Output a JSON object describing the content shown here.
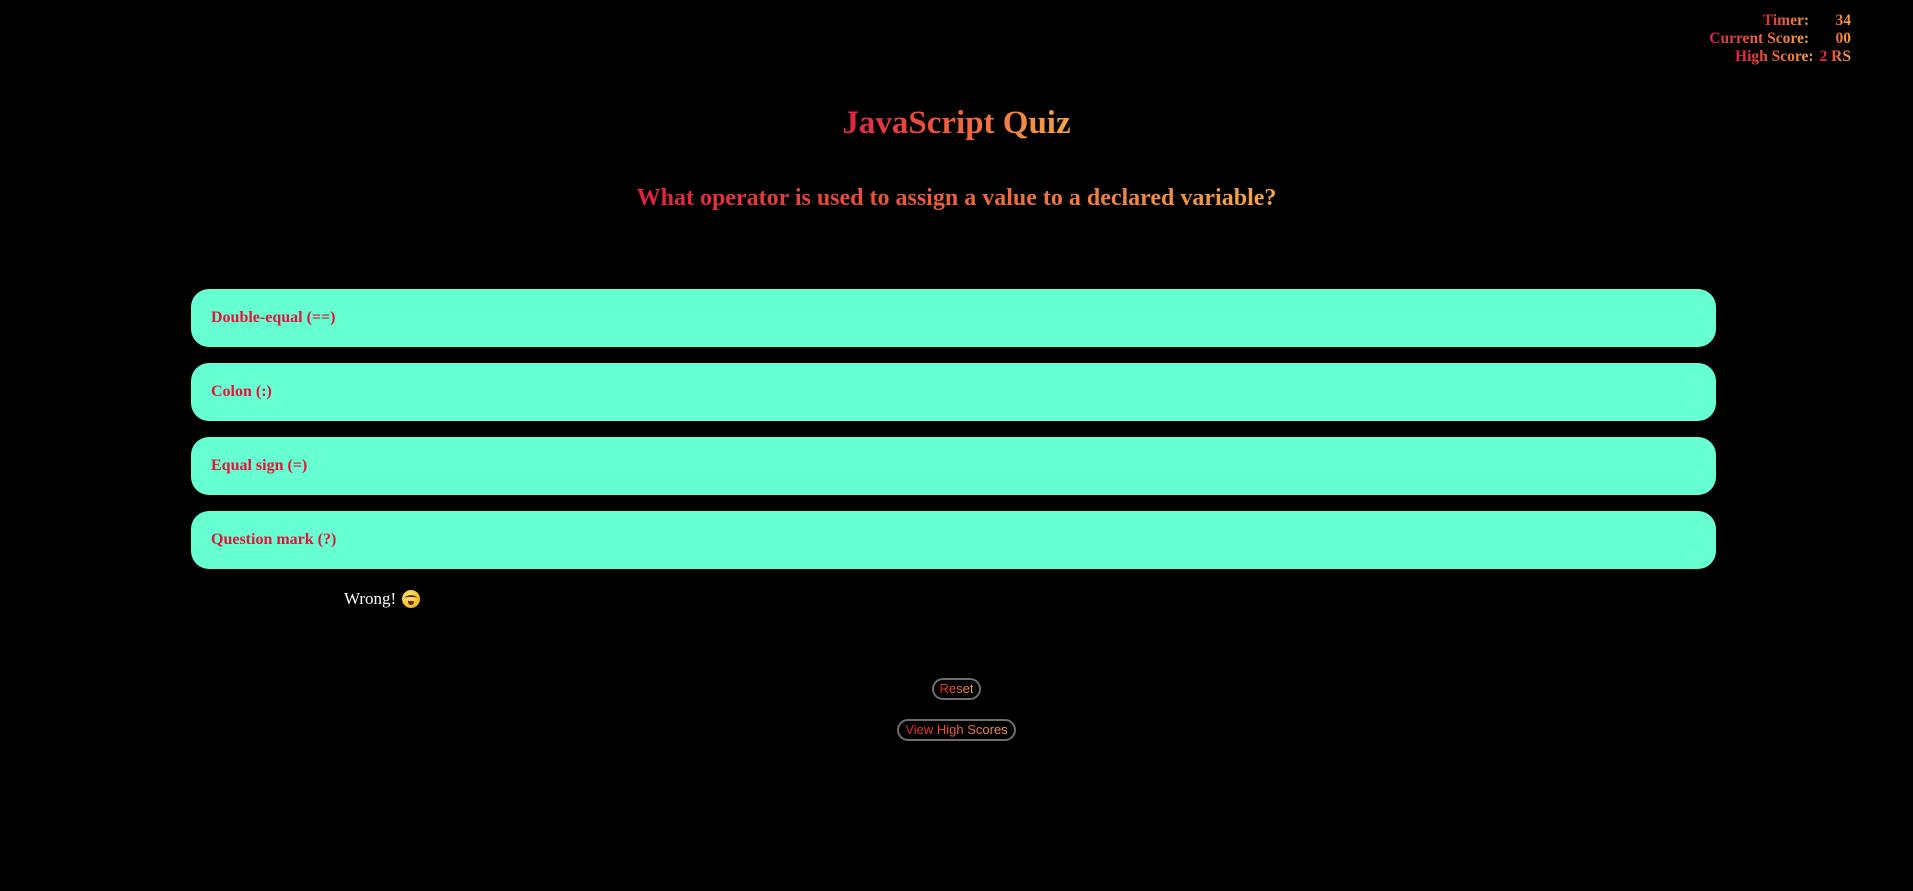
{
  "scoreboard": {
    "timer_label": "Timer:",
    "timer_value": "34",
    "current_label": "Current Score:",
    "current_value": "00",
    "high_label": "High Score:",
    "high_value": "2 RS"
  },
  "title": "JavaScript Quiz",
  "question": "What operator is used to assign a value to a declared variable?",
  "answers": [
    {
      "label": "Double-equal (==)"
    },
    {
      "label": "Colon (:)"
    },
    {
      "label": "Equal sign (=)"
    },
    {
      "label": "Question mark (?)"
    }
  ],
  "feedback": {
    "text": "Wrong!",
    "icon": "dizzy-face-emoji"
  },
  "buttons": {
    "reset": "Reset",
    "view_high_scores": "View High Scores"
  },
  "colors": {
    "background": "#000000",
    "answer_bg": "#66ffd1",
    "answer_text": "#e3143a",
    "gradient_start": "#e0213f",
    "gradient_end": "#f5a548",
    "feedback_text": "#ffffff"
  }
}
